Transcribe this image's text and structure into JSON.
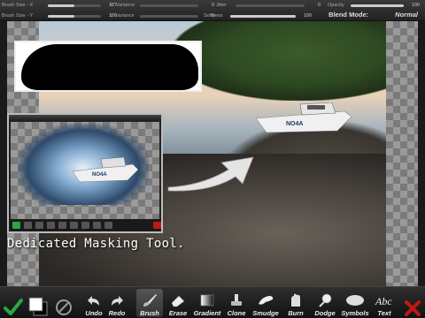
{
  "top_panel": {
    "sliders": [
      {
        "label": "Brush Size - X",
        "value": "127",
        "level": 0.5
      },
      {
        "label": "X: Variance",
        "value": "0",
        "level": 0.0
      },
      {
        "label": "Jitter",
        "value": "0",
        "level": 0.0
      },
      {
        "label": "Opacity",
        "value": "100",
        "level": 1.0
      },
      {
        "label": "Brush Size - Y",
        "value": "126",
        "level": 0.5
      },
      {
        "label": "Y: Variance",
        "value": "0",
        "level": 0.0
      },
      {
        "label": "Softness",
        "value": "100",
        "level": 1.0
      }
    ],
    "blend_label": "Blend Mode:",
    "blend_value": "Normal"
  },
  "caption": "Dedicated Masking Tool.",
  "toolbar": {
    "undo": "Undo",
    "redo": "Redo",
    "tools": [
      "Brush",
      "Erase",
      "Gradient",
      "Clone",
      "Smudge",
      "Burn",
      "Dodge",
      "Symbols",
      "Text"
    ],
    "active_tool": "Brush"
  },
  "colors": {
    "accept": "#27a844",
    "cancel": "#c01818"
  }
}
